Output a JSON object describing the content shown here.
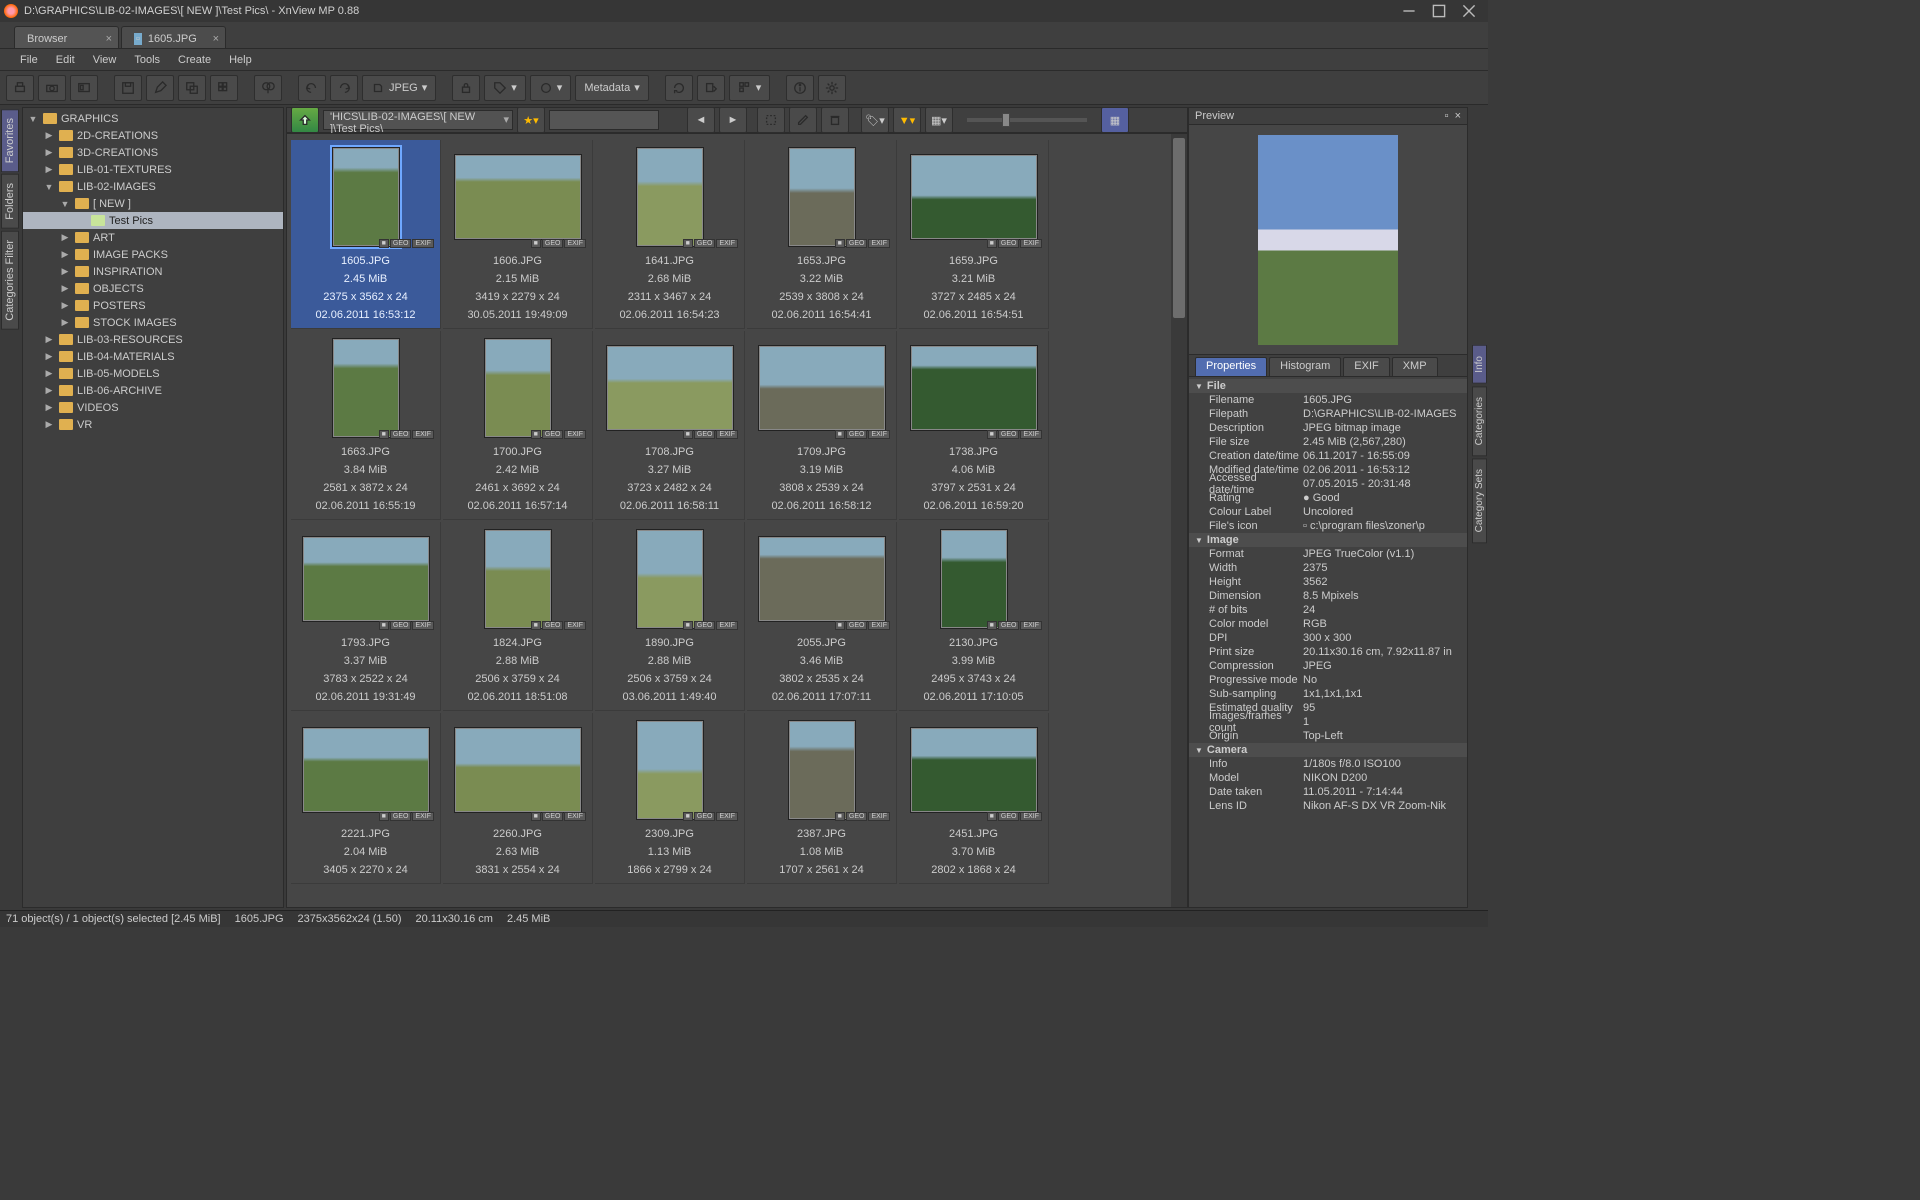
{
  "window": {
    "title": "D:\\GRAPHICS\\LIB-02-IMAGES\\[ NEW ]\\Test Pics\\ - XnView MP 0.88"
  },
  "doc_tabs": [
    {
      "label": "Browser",
      "active": true
    },
    {
      "label": "1605.JPG",
      "active": false,
      "icon": true
    }
  ],
  "menus": [
    "File",
    "Edit",
    "View",
    "Tools",
    "Create",
    "Help"
  ],
  "toolbar": {
    "convert_label": "JPEG",
    "metadata_label": "Metadata"
  },
  "left_vtabs": [
    "Favorites",
    "Folders",
    "Categories Filter"
  ],
  "right_vtabs": [
    "Info",
    "Categories",
    "Category Sets"
  ],
  "tree": [
    {
      "d": 0,
      "name": "GRAPHICS",
      "open": true
    },
    {
      "d": 1,
      "name": "2D-CREATIONS"
    },
    {
      "d": 1,
      "name": "3D-CREATIONS"
    },
    {
      "d": 1,
      "name": "LIB-01-TEXTURES"
    },
    {
      "d": 1,
      "name": "LIB-02-IMAGES",
      "open": true
    },
    {
      "d": 2,
      "name": "[ NEW ]",
      "open": true
    },
    {
      "d": 3,
      "name": "Test Pics",
      "sel": true,
      "leaf": true
    },
    {
      "d": 2,
      "name": "ART"
    },
    {
      "d": 2,
      "name": "IMAGE PACKS"
    },
    {
      "d": 2,
      "name": "INSPIRATION"
    },
    {
      "d": 2,
      "name": "OBJECTS"
    },
    {
      "d": 2,
      "name": "POSTERS"
    },
    {
      "d": 2,
      "name": "STOCK IMAGES"
    },
    {
      "d": 1,
      "name": "LIB-03-RESOURCES"
    },
    {
      "d": 1,
      "name": "LIB-04-MATERIALS"
    },
    {
      "d": 1,
      "name": "LIB-05-MODELS"
    },
    {
      "d": 1,
      "name": "LIB-06-ARCHIVE"
    },
    {
      "d": 1,
      "name": "VIDEOS"
    },
    {
      "d": 1,
      "name": "VR"
    }
  ],
  "location": "'HICS\\LIB-02-IMAGES\\[ NEW ]\\Test Pics\\",
  "thumbs": [
    {
      "name": "1605.JPG",
      "size": "2.45 MiB",
      "dim": "2375 x 3562 x 24",
      "date": "02.06.2011 16:53:12",
      "o": "p",
      "sel": true
    },
    {
      "name": "1606.JPG",
      "size": "2.15 MiB",
      "dim": "3419 x 2279 x 24",
      "date": "30.05.2011 19:49:09",
      "o": "l"
    },
    {
      "name": "1641.JPG",
      "size": "2.68 MiB",
      "dim": "2311 x 3467 x 24",
      "date": "02.06.2011 16:54:23",
      "o": "p"
    },
    {
      "name": "1653.JPG",
      "size": "3.22 MiB",
      "dim": "2539 x 3808 x 24",
      "date": "02.06.2011 16:54:41",
      "o": "p"
    },
    {
      "name": "1659.JPG",
      "size": "3.21 MiB",
      "dim": "3727 x 2485 x 24",
      "date": "02.06.2011 16:54:51",
      "o": "l"
    },
    {
      "name": "1663.JPG",
      "size": "3.84 MiB",
      "dim": "2581 x 3872 x 24",
      "date": "02.06.2011 16:55:19",
      "o": "p"
    },
    {
      "name": "1700.JPG",
      "size": "2.42 MiB",
      "dim": "2461 x 3692 x 24",
      "date": "02.06.2011 16:57:14",
      "o": "p"
    },
    {
      "name": "1708.JPG",
      "size": "3.27 MiB",
      "dim": "3723 x 2482 x 24",
      "date": "02.06.2011 16:58:11",
      "o": "l"
    },
    {
      "name": "1709.JPG",
      "size": "3.19 MiB",
      "dim": "3808 x 2539 x 24",
      "date": "02.06.2011 16:58:12",
      "o": "l"
    },
    {
      "name": "1738.JPG",
      "size": "4.06 MiB",
      "dim": "3797 x 2531 x 24",
      "date": "02.06.2011 16:59:20",
      "o": "l"
    },
    {
      "name": "1793.JPG",
      "size": "3.37 MiB",
      "dim": "3783 x 2522 x 24",
      "date": "02.06.2011 19:31:49",
      "o": "l"
    },
    {
      "name": "1824.JPG",
      "size": "2.88 MiB",
      "dim": "2506 x 3759 x 24",
      "date": "02.06.2011 18:51:08",
      "o": "p"
    },
    {
      "name": "1890.JPG",
      "size": "2.88 MiB",
      "dim": "2506 x 3759 x 24",
      "date": "03.06.2011 1:49:40",
      "o": "p"
    },
    {
      "name": "2055.JPG",
      "size": "3.46 MiB",
      "dim": "3802 x 2535 x 24",
      "date": "02.06.2011 17:07:11",
      "o": "l"
    },
    {
      "name": "2130.JPG",
      "size": "3.99 MiB",
      "dim": "2495 x 3743 x 24",
      "date": "02.06.2011 17:10:05",
      "o": "p"
    },
    {
      "name": "2221.JPG",
      "size": "2.04 MiB",
      "dim": "3405 x 2270 x 24",
      "date": "",
      "o": "l"
    },
    {
      "name": "2260.JPG",
      "size": "2.63 MiB",
      "dim": "3831 x 2554 x 24",
      "date": "",
      "o": "l"
    },
    {
      "name": "2309.JPG",
      "size": "1.13 MiB",
      "dim": "1866 x 2799 x 24",
      "date": "",
      "o": "p"
    },
    {
      "name": "2387.JPG",
      "size": "1.08 MiB",
      "dim": "1707 x 2561 x 24",
      "date": "",
      "o": "p"
    },
    {
      "name": "2451.JPG",
      "size": "3.70 MiB",
      "dim": "2802 x 1868 x 24",
      "date": "",
      "o": "l"
    }
  ],
  "preview": {
    "title": "Preview"
  },
  "info_tabs": [
    "Properties",
    "Histogram",
    "EXIF",
    "XMP"
  ],
  "props": [
    {
      "grp": "File"
    },
    {
      "k": "Filename",
      "v": "1605.JPG"
    },
    {
      "k": "Filepath",
      "v": "D:\\GRAPHICS\\LIB-02-IMAGES"
    },
    {
      "k": "Description",
      "v": "JPEG bitmap image"
    },
    {
      "k": "File size",
      "v": "2.45 MiB (2,567,280)"
    },
    {
      "k": "Creation date/time",
      "v": "06.11.2017 - 16:55:09"
    },
    {
      "k": "Modified date/time",
      "v": "02.06.2011 - 16:53:12"
    },
    {
      "k": "Accessed date/time",
      "v": "07.05.2015 - 20:31:48"
    },
    {
      "k": "Rating",
      "v": "● Good"
    },
    {
      "k": "Colour Label",
      "v": "Uncolored"
    },
    {
      "k": "File's icon",
      "v": "▫ c:\\program files\\zoner\\p"
    },
    {
      "grp": "Image"
    },
    {
      "k": "Format",
      "v": "JPEG TrueColor (v1.1)"
    },
    {
      "k": "Width",
      "v": "2375"
    },
    {
      "k": "Height",
      "v": "3562"
    },
    {
      "k": "Dimension",
      "v": "8.5 Mpixels"
    },
    {
      "k": "# of bits",
      "v": "24"
    },
    {
      "k": "Color model",
      "v": "RGB"
    },
    {
      "k": "DPI",
      "v": "300 x 300"
    },
    {
      "k": "Print size",
      "v": "20.11x30.16 cm, 7.92x11.87 in"
    },
    {
      "k": "Compression",
      "v": "JPEG"
    },
    {
      "k": "Progressive mode",
      "v": "No"
    },
    {
      "k": "Sub-sampling",
      "v": "1x1,1x1,1x1"
    },
    {
      "k": "Estimated quality",
      "v": "95"
    },
    {
      "k": "Images/frames count",
      "v": "1"
    },
    {
      "k": "Origin",
      "v": "Top-Left"
    },
    {
      "grp": "Camera"
    },
    {
      "k": "Info",
      "v": "1/180s f/8.0 ISO100"
    },
    {
      "k": "Model",
      "v": "NIKON D200"
    },
    {
      "k": "Date taken",
      "v": "11.05.2011 - 7:14:44"
    },
    {
      "k": "Lens ID",
      "v": "Nikon AF-S DX VR Zoom-Nik"
    }
  ],
  "status": {
    "objects": "71 object(s) / 1 object(s) selected [2.45 MiB]",
    "file": "1605.JPG",
    "dims": "2375x3562x24 (1.50)",
    "print": "20.11x30.16 cm",
    "size": "2.45 MiB"
  }
}
